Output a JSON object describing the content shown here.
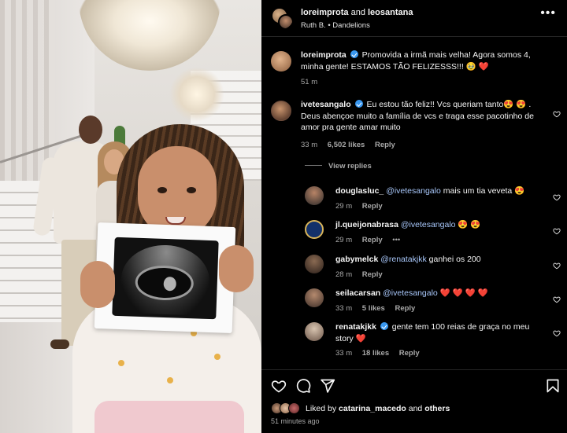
{
  "post": {
    "header": {
      "user1": "loreimprota",
      "and_text": "and",
      "user2": "leosantana",
      "audio": "Ruth B. • Dandelions"
    },
    "caption": {
      "user": "loreimprota",
      "text": "Promovida a irmã mais velha! Agora somos 4, minha gente! ESTAMOS TÃO FELIZESSS!!! 🥹 ❤️",
      "time": "51 m"
    },
    "comments": [
      {
        "user": "ivetesangalo",
        "verified": true,
        "mention": "",
        "text": "Eu estou tão feliz!! Vcs queriam tanto😍 😍 . Deus abençoe muito a família de vcs e traga esse pacotinho de amor pra gente amar muito",
        "time": "33 m",
        "likes": "6,502 likes",
        "reply": "Reply"
      }
    ],
    "view_replies": "View replies",
    "replies": [
      {
        "user": "douglasluc_",
        "verified": false,
        "mention": "@ivetesangalo",
        "text": "mais um tia veveta 😍",
        "time": "29 m",
        "likes": "",
        "reply": "Reply",
        "extra": ""
      },
      {
        "user": "jl.queijonabrasa",
        "verified": false,
        "mention": "@ivetesangalo",
        "text": "😍 😍",
        "time": "29 m",
        "likes": "",
        "reply": "Reply",
        "extra": "•••"
      },
      {
        "user": "gabymelck",
        "verified": false,
        "mention": "@renatakjkk",
        "text": "ganhei os 200",
        "time": "28 m",
        "likes": "",
        "reply": "Reply",
        "extra": ""
      },
      {
        "user": "seilacarsan",
        "verified": false,
        "mention": "@ivetesangalo",
        "text": "❤️ ❤️ ❤️ ❤️",
        "time": "33 m",
        "likes": "5 likes",
        "reply": "Reply",
        "extra": ""
      },
      {
        "user": "renatakjkk",
        "verified": true,
        "mention": "",
        "text": "gente tem 100 reias de graça no meu story ❤️",
        "time": "33 m",
        "likes": "18 likes",
        "reply": "Reply",
        "extra": ""
      }
    ],
    "footer": {
      "liked_prefix": "Liked by",
      "liked_user": "catarina_macedo",
      "liked_and": "and",
      "liked_others": "others",
      "time_ago": "51 minutes ago"
    },
    "icons": {
      "like": "heart-icon",
      "comment": "comment-icon",
      "share": "share-icon",
      "save": "bookmark-icon",
      "more": "more-options-icon"
    },
    "colors": {
      "background": "#000000",
      "text": "#f5f5f5",
      "secondary": "#a8a8a8",
      "mention": "#a8c7fa",
      "verified": "#3897f0"
    }
  }
}
